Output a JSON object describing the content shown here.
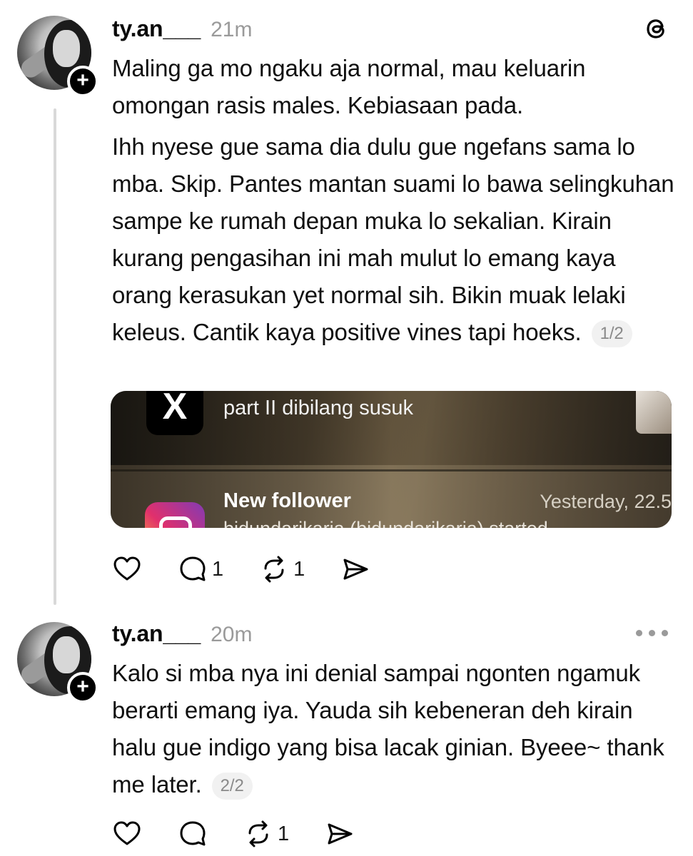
{
  "posts": [
    {
      "username": "ty.an___",
      "time": "21m",
      "paragraphs": [
        "Maling ga mo ngaku aja normal, mau keluarin omongan rasis males. Kebiasaan pada.",
        "Ihh nyese gue sama dia dulu gue ngefans sama lo mba. Skip. Pantes mantan suami lo bawa selingkuhan sampe ke rumah depan muka lo sekalian. Kirain kurang pengasihan ini mah mulut lo emang kaya orang kerasukan yet normal sih. Bikin muak lelaki keleus. Cantik kaya positive vines tapi hoeks."
      ],
      "pager": "1/2",
      "media": {
        "notif1": "part II dibilang susuk",
        "notif2_title": "New follower",
        "notif2_time": "Yesterday, 22.5",
        "notif2_sub": "bidundarikaria (bidundarikaria) started"
      },
      "actions": {
        "like": "",
        "reply": "1",
        "repost": "1"
      },
      "corner_icon": "threads-logo-icon"
    },
    {
      "username": "ty.an___",
      "time": "20m",
      "paragraphs": [
        "Kalo si mba nya ini denial sampai ngonten ngamuk berarti emang iya. Yauda sih kebeneran deh kirain halu gue indigo yang bisa lacak ginian. Byeee~ thank me later."
      ],
      "pager": "2/2",
      "actions": {
        "like": "",
        "reply": "",
        "repost": "1"
      },
      "corner_icon": "more-options-icon"
    }
  ]
}
